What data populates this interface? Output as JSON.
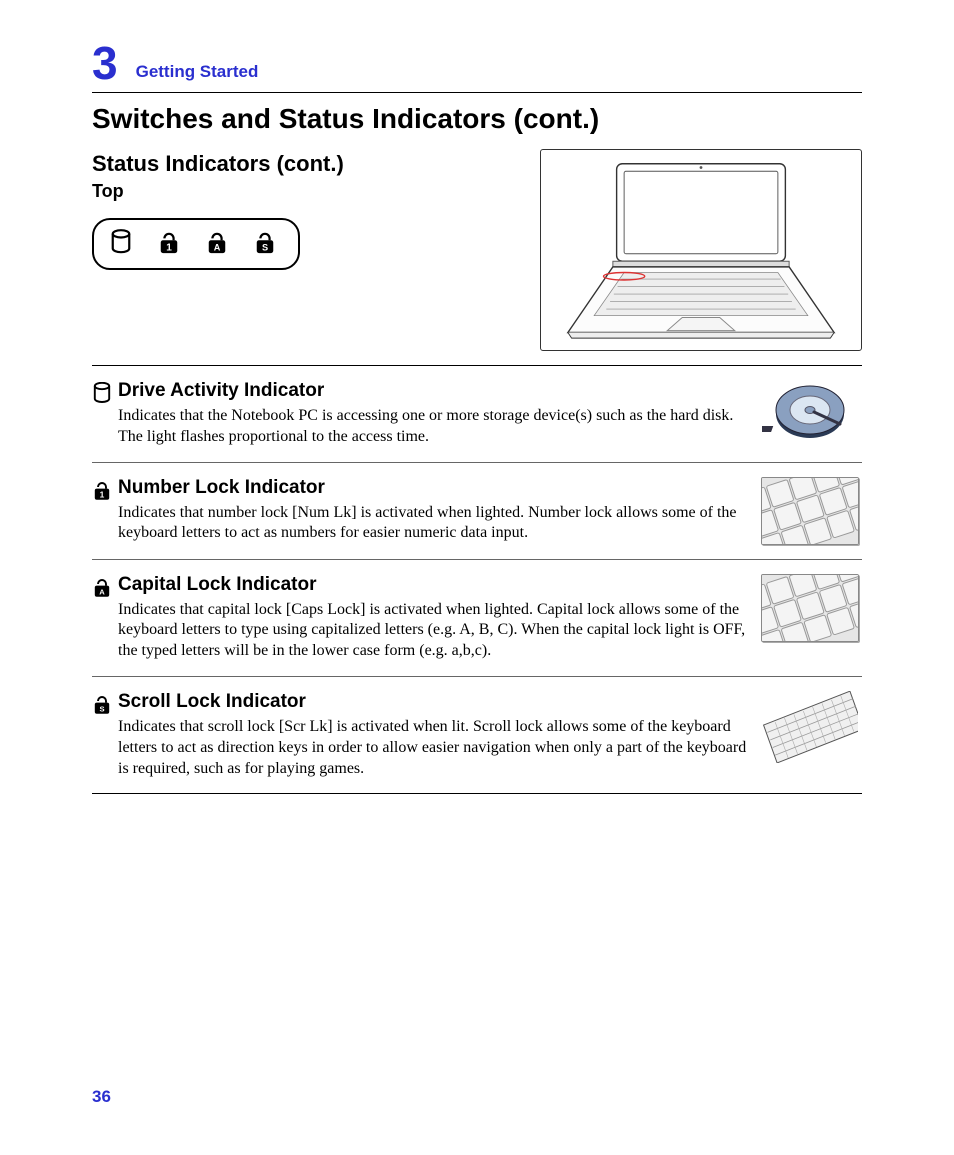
{
  "chapter": {
    "number": "3",
    "label": "Getting Started"
  },
  "page_title": "Switches and Status Indicators (cont.)",
  "section_title": "Status Indicators (cont.)",
  "subhead": "Top",
  "page_number": "36",
  "items": [
    {
      "icon": "cylinder",
      "title": "Drive Activity Indicator",
      "text": "Indicates that the Notebook PC is accessing one or more storage device(s) such as the hard disk. The light flashes proportional to the access time."
    },
    {
      "icon": "lock-1",
      "title": "Number Lock Indicator",
      "text": "Indicates that number lock [Num Lk] is activated when lighted. Number lock allows some of the  keyboard letters to act as numbers for easier numeric data input."
    },
    {
      "icon": "lock-a",
      "title": "Capital Lock Indicator",
      "text": "Indicates that capital lock [Caps Lock] is activated when lighted. Capital lock allows some of the keyboard letters to type using capitalized letters (e.g. A, B, C). When the capital lock light is OFF, the typed letters will be in the lower case form (e.g. a,b,c)."
    },
    {
      "icon": "lock-s",
      "title": "Scroll Lock Indicator",
      "text": "Indicates that scroll lock [Scr Lk] is activated when lit. Scroll lock allows some of the keyboard letters to act as direction keys in order to allow easier navigation when only a part of the keyboard is required, such as for playing games."
    }
  ]
}
